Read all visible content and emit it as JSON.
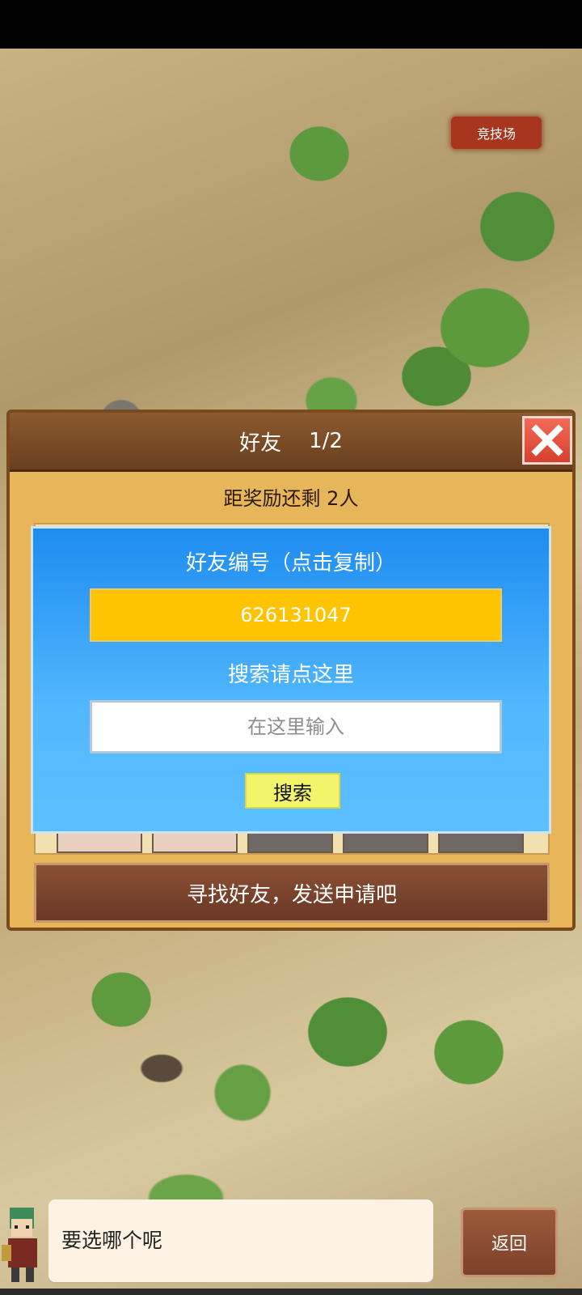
{
  "game": {
    "arena_label": "竞技场"
  },
  "friends_panel": {
    "title": "好友",
    "page": "1/2",
    "reward_text": "距奖励还剩 2人",
    "find_friends_label": "寻找好友，发送申请吧"
  },
  "search_dialog": {
    "title": "好友编号（点击复制）",
    "friend_code": "626131047",
    "search_hint": "搜索请点这里",
    "input_placeholder": "在这里输入",
    "input_value": "",
    "search_button_label": "搜索"
  },
  "dialogue": {
    "text": "要选哪个呢",
    "back_label": "返回"
  },
  "icons": {
    "close": "close-icon",
    "left_arrow": "arrow-left-icon",
    "right_arrow": "arrow-right-icon"
  },
  "colors": {
    "panel_bg": "#e8b65a",
    "header_brown": "#6b3f1e",
    "dialog_blue": "#1e8cf0",
    "code_box": "#ffc400",
    "search_button": "#f2f56a",
    "close_red": "#d7402c"
  }
}
